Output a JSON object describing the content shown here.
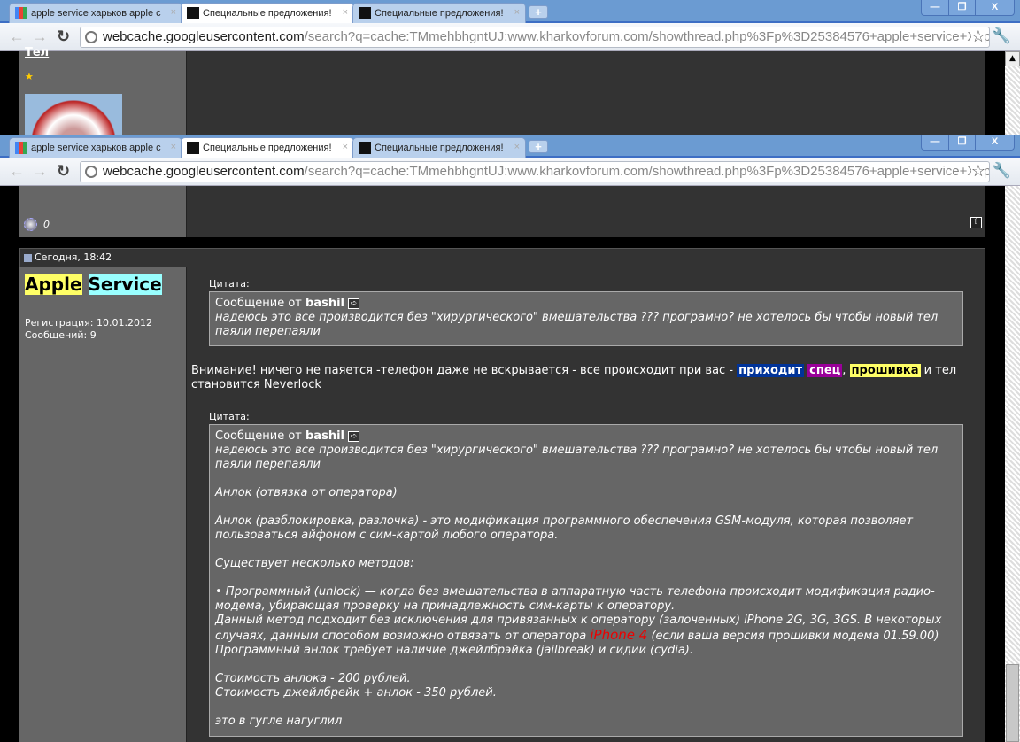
{
  "browser": {
    "tabs": [
      {
        "title": "apple service харьков apple с",
        "icon": "google-icon"
      },
      {
        "title": "Специальные предложения!",
        "icon": "forum-icon"
      },
      {
        "title": "Специальные предложения!",
        "icon": "forum-icon"
      }
    ],
    "tab_close": "×",
    "new_tab": "+",
    "url_host": "webcache.googleusercontent.com",
    "url_rest": "/search?q=cache:TMmehbhgntUJ:www.kharkovforum.com/showthread.php%3Fp%3D25384576+apple+service+Харьков+",
    "window_buttons": {
      "minimize": "—",
      "restore": "❐",
      "close": "X"
    }
  },
  "prev_post": {
    "username_fragment": "Тел",
    "status_count": "0"
  },
  "post": {
    "date": "Сегодня, 18:42",
    "author": {
      "first": "Apple",
      "second": "Service",
      "first_bg": "#ffff66",
      "second_bg": "#99ffff"
    },
    "registration": "Регистрация: 10.01.2012",
    "messages": "Сообщений: 9",
    "quote_label": "Цитата:",
    "quote1": {
      "from_prefix": "Сообщение от",
      "from_user": "bashil",
      "lines": [
        "надеюсь это все производится без \"хирургического\" вмешательства ??? програмно? не хотелось бы чтобы новый тел",
        "паяли перепаяли"
      ]
    },
    "reply": {
      "before": "Внимание! ничего не паяется -телефон даже не вскрывается - все происходит при вас - ",
      "hl1": "приходит",
      "hl2": "спец",
      "sep": ", ",
      "hl3": "прошивка",
      "after": " и тел становится Neverlock",
      "hl1_bg": "#003399",
      "hl2_bg": "#990099",
      "hl3_bg": "#ffff66"
    },
    "quote2": {
      "from_prefix": "Сообщение от",
      "from_user": "bashil",
      "p1a": "надеюсь это все производится без \"хирургического\" вмешательства ??? програмно? не хотелось бы чтобы новый тел",
      "p1b": "паяли перепаяли",
      "p2": "Анлок (отвязка от оператора)",
      "p3": "Анлок (разблокировка, разлочка) - это модификация программного обеспечения GSM-модуля, которая позволяет пользоваться айфоном с сим-картой любого оператора.",
      "p4": "Существует несколько методов:",
      "p5": "• Программный (unlock) — когда без вмешательства в аппаратную часть телефона происходит модификация радио-модема, убирающая проверку на принадлежность сим-карты к оператору.",
      "p6a": "Данный метод подходит без исключения для привязанных к оператору (залоченных) iPhone 2G, 3G, 3GS. В некоторых случаях, данным способом возможно отвязать от оператора ",
      "p6red": "iPhone 4",
      "p6b": " (если ваша версия прошивки модема 01.59.00)",
      "p7": "Программный анлок требует наличие джейлбрэйка (jailbreak) и сидии (cydia).",
      "p8": "Стоимость анлока - 200 рублей.",
      "p9": "Стоимость джейлбрейк + анлок - 350 рублей.",
      "p10": "это в гугле нагуглил"
    }
  }
}
